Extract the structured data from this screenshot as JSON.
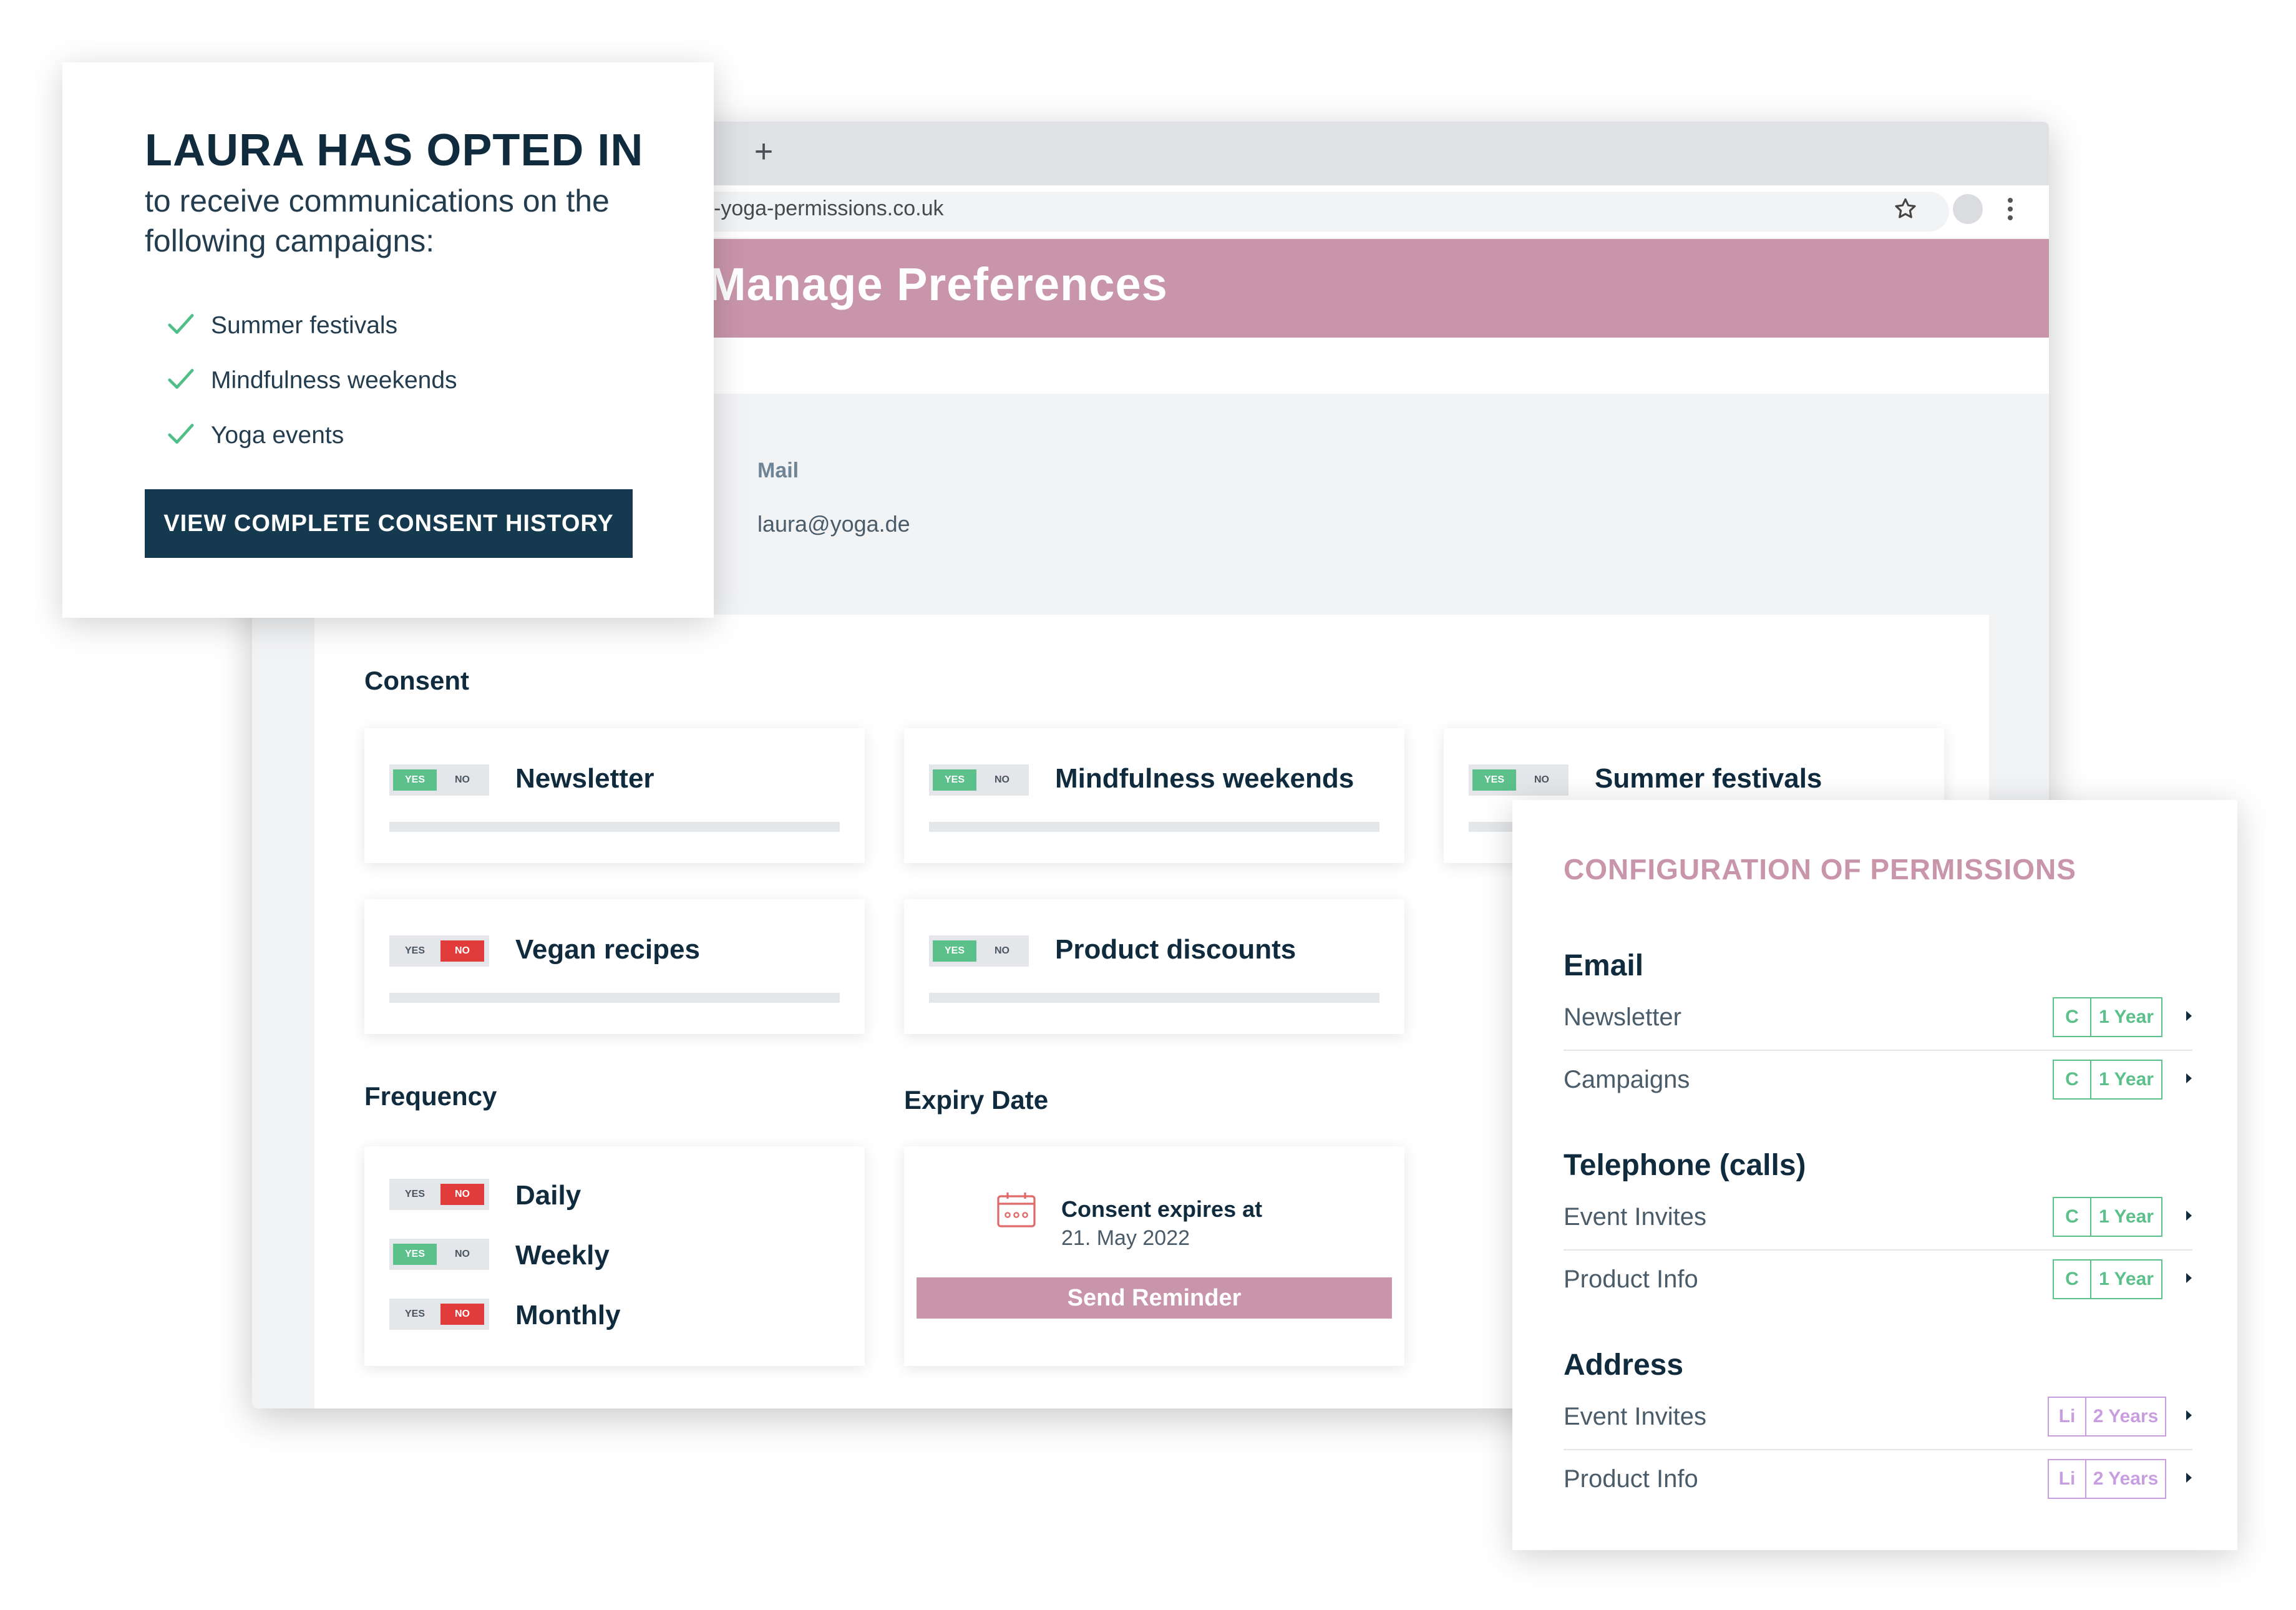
{
  "browser": {
    "url": "-yoga-permissions.co.uk",
    "new_tab_label": "+",
    "page_title": "Manage Preferences"
  },
  "mail": {
    "label": "Mail",
    "value": "laura@yoga.de"
  },
  "consent": {
    "heading": "Consent",
    "items": [
      {
        "label": "Newsletter",
        "yes": "YES",
        "no": "NO",
        "state": "yes"
      },
      {
        "label": "Mindfulness weekends",
        "yes": "YES",
        "no": "NO",
        "state": "yes"
      },
      {
        "label": "Summer festivals",
        "yes": "YES",
        "no": "NO",
        "state": "yes"
      },
      {
        "label": "Vegan recipes",
        "yes": "YES",
        "no": "NO",
        "state": "no"
      },
      {
        "label": "Product discounts",
        "yes": "YES",
        "no": "NO",
        "state": "yes"
      }
    ]
  },
  "frequency": {
    "heading": "Frequency",
    "items": [
      {
        "label": "Daily",
        "yes": "YES",
        "no": "NO",
        "state": "no"
      },
      {
        "label": "Weekly",
        "yes": "YES",
        "no": "NO",
        "state": "yes"
      },
      {
        "label": "Monthly",
        "yes": "YES",
        "no": "NO",
        "state": "no"
      }
    ]
  },
  "expiry": {
    "heading": "Expiry Date",
    "title": "Consent expires at",
    "date": "21. May 2022",
    "button": "Send Reminder"
  },
  "opted_in": {
    "title": "LAURA HAS OPTED IN",
    "subtitle": "to receive communications on the following campaigns:",
    "items": [
      "Summer festivals",
      "Mindfulness weekends",
      "Yoga events"
    ],
    "button": "VIEW COMPLETE CONSENT HISTORY"
  },
  "permissions": {
    "title": "CONFIGURATION OF PERMISSIONS",
    "groups": [
      {
        "name": "Email",
        "rows": [
          {
            "label": "Newsletter",
            "code": "C",
            "duration": "1 Year"
          },
          {
            "label": "Campaigns",
            "code": "C",
            "duration": "1 Year"
          }
        ]
      },
      {
        "name": "Telephone (calls)",
        "rows": [
          {
            "label": "Event Invites",
            "code": "C",
            "duration": "1 Year"
          },
          {
            "label": "Product Info",
            "code": "C",
            "duration": "1 Year"
          }
        ]
      },
      {
        "name": "Address",
        "rows": [
          {
            "label": "Event Invites",
            "code": "Li",
            "duration": "2 Years"
          },
          {
            "label": "Product Info",
            "code": "Li",
            "duration": "2 Years"
          }
        ]
      }
    ]
  },
  "colors": {
    "accent_pink": "#c995aa",
    "navy": "#0f2b3d",
    "button_navy": "#15394f",
    "toggle_yes_green": "#5cc08a",
    "toggle_no_red": "#e23b3b",
    "badge_green": "#5cc08a",
    "badge_purple": "#c99ee0"
  }
}
